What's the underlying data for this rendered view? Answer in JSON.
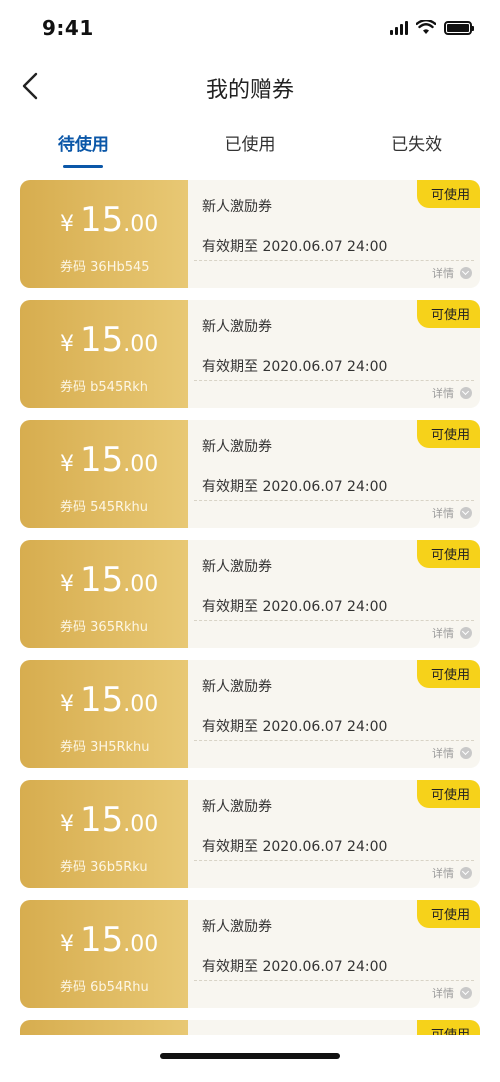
{
  "status_bar": {
    "time": "9:41"
  },
  "nav": {
    "title": "我的赠券"
  },
  "tabs": [
    {
      "label": "待使用",
      "active": true
    },
    {
      "label": "已使用",
      "active": false
    },
    {
      "label": "已失效",
      "active": false
    }
  ],
  "coupons": [
    {
      "currency": "¥",
      "amount_int": "15",
      "amount_dec": ".00",
      "code_label": "券码",
      "code": "36Hb545",
      "name": "新人激励券",
      "validity": "有效期至 2020.06.07 24:00",
      "status": "可使用",
      "detail_label": "详情"
    },
    {
      "currency": "¥",
      "amount_int": "15",
      "amount_dec": ".00",
      "code_label": "券码",
      "code": "b545Rkh",
      "name": "新人激励券",
      "validity": "有效期至 2020.06.07 24:00",
      "status": "可使用",
      "detail_label": "详情"
    },
    {
      "currency": "¥",
      "amount_int": "15",
      "amount_dec": ".00",
      "code_label": "券码",
      "code": "545Rkhu",
      "name": "新人激励券",
      "validity": "有效期至 2020.06.07 24:00",
      "status": "可使用",
      "detail_label": "详情"
    },
    {
      "currency": "¥",
      "amount_int": "15",
      "amount_dec": ".00",
      "code_label": "券码",
      "code": "365Rkhu",
      "name": "新人激励券",
      "validity": "有效期至 2020.06.07 24:00",
      "status": "可使用",
      "detail_label": "详情"
    },
    {
      "currency": "¥",
      "amount_int": "15",
      "amount_dec": ".00",
      "code_label": "券码",
      "code": "3H5Rkhu",
      "name": "新人激励券",
      "validity": "有效期至 2020.06.07 24:00",
      "status": "可使用",
      "detail_label": "详情"
    },
    {
      "currency": "¥",
      "amount_int": "15",
      "amount_dec": ".00",
      "code_label": "券码",
      "code": "36b5Rku",
      "name": "新人激励券",
      "validity": "有效期至 2020.06.07 24:00",
      "status": "可使用",
      "detail_label": "详情"
    },
    {
      "currency": "¥",
      "amount_int": "15",
      "amount_dec": ".00",
      "code_label": "券码",
      "code": "6b54Rhu",
      "name": "新人激励券",
      "validity": "有效期至 2020.06.07 24:00",
      "status": "可使用",
      "detail_label": "详情"
    },
    {
      "currency": "",
      "amount_int": "",
      "amount_dec": "",
      "code_label": "",
      "code": "",
      "name": "",
      "validity": "",
      "status": "可使用",
      "detail_label": ""
    }
  ],
  "colors": {
    "accent": "#0b57a8",
    "coupon_gold_start": "#d7ad4f",
    "coupon_gold_end": "#e8c874",
    "badge_yellow": "#f6d21a",
    "card_bg": "#f8f6f0"
  },
  "icons": [
    "signal-icon",
    "wifi-icon",
    "battery-icon",
    "back-arrow-icon",
    "chevron-down-icon"
  ]
}
